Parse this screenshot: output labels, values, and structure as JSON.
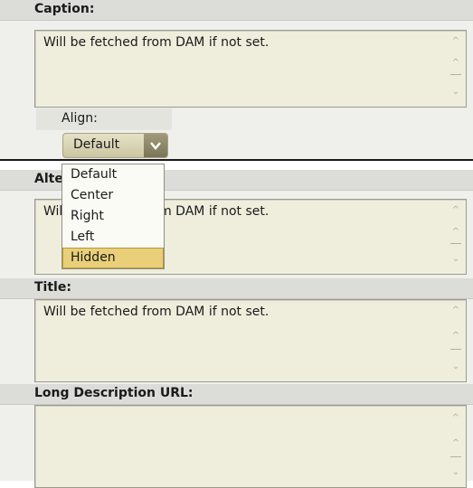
{
  "caption": {
    "title": "Caption:",
    "text": "Will be fetched from DAM if not set.",
    "align_label": "Align:",
    "select_value": "Default",
    "options": [
      "Default",
      "Center",
      "Right",
      "Left",
      "Hidden"
    ],
    "highlighted_option": "Hidden"
  },
  "alt_text": {
    "title": "Alternative Text:",
    "text": "Will be fetched from DAM if not set."
  },
  "title_field": {
    "title": "Title:",
    "text": "Will be fetched from DAM if not set."
  },
  "long_description": {
    "title": "Long Description URL:",
    "text": ""
  }
}
